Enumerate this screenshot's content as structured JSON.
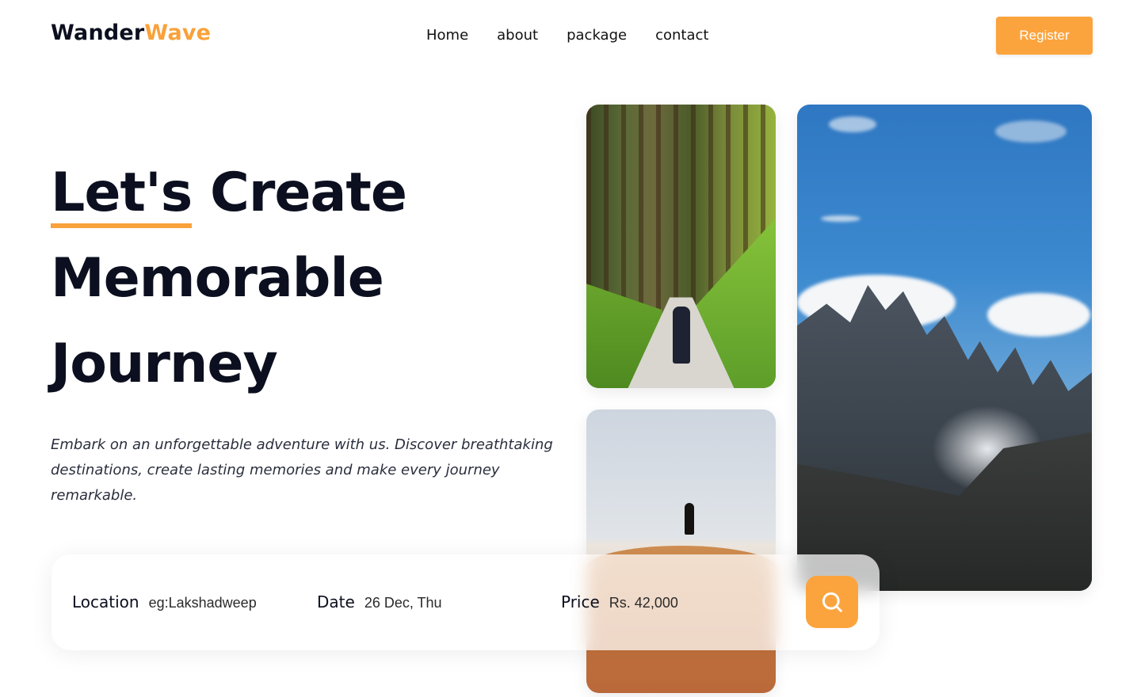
{
  "brand": {
    "part1": "Wander",
    "part2": "Wave",
    "accent_color": "#f9a13a"
  },
  "nav": {
    "items": [
      {
        "label": "Home"
      },
      {
        "label": "about"
      },
      {
        "label": "package"
      },
      {
        "label": "contact"
      }
    ],
    "register_label": "Register"
  },
  "hero": {
    "title_word1": "Let's",
    "title_rest_line1": "Create",
    "title_line2": "Memorable",
    "title_line3": "Journey",
    "description": "Embark on an unforgettable adventure with us. Discover breathtaking destinations, create lasting memories and make every journey remarkable."
  },
  "images": [
    {
      "icon": "forest-trail-photo"
    },
    {
      "icon": "desert-dune-photo"
    },
    {
      "icon": "mountain-peaks-photo"
    }
  ],
  "search": {
    "location": {
      "label": "Location",
      "placeholder": "eg:Lakshadweep"
    },
    "date": {
      "label": "Date",
      "placeholder": "26 Dec, Thu"
    },
    "price": {
      "label": "Price",
      "placeholder": "Rs. 42,000"
    },
    "button_icon": "search-icon",
    "button_color": "#fba43e"
  }
}
